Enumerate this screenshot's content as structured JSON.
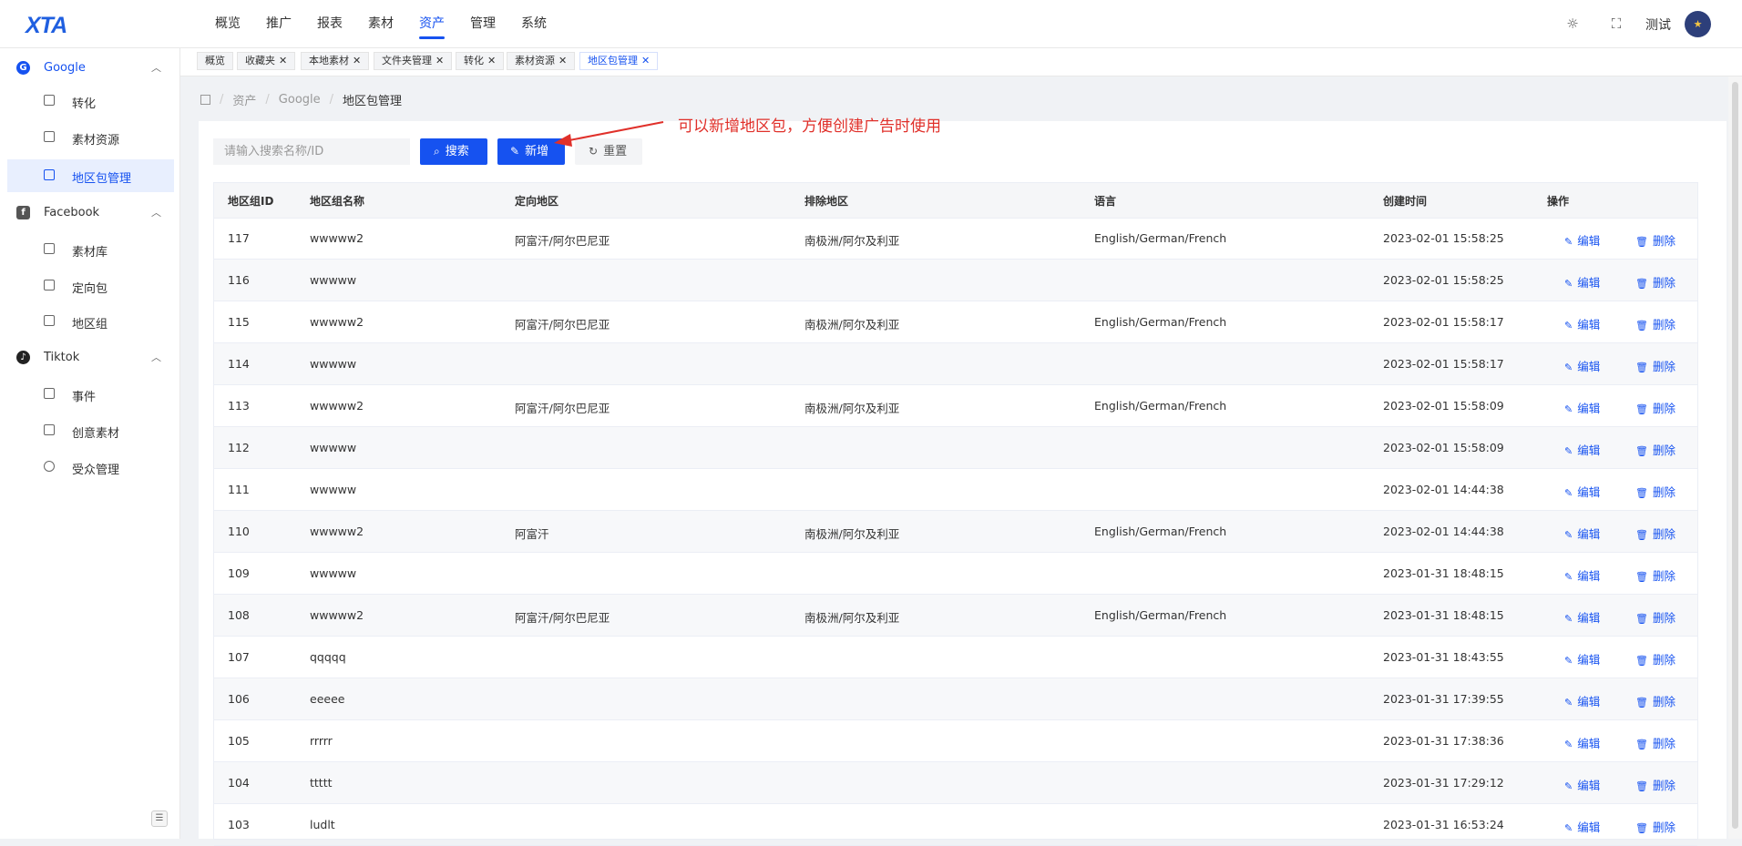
{
  "header": {
    "logo": "XTA",
    "nav": [
      "概览",
      "推广",
      "报表",
      "素材",
      "资产",
      "管理",
      "系统"
    ],
    "active_nav": "资产",
    "username": "测试"
  },
  "sidebar": {
    "groups": [
      {
        "label": "Google",
        "icon": "google-icon",
        "expanded": true,
        "items": [
          {
            "label": "转化",
            "icon": "paint-roller-icon"
          },
          {
            "label": "素材资源",
            "icon": "tv-icon"
          },
          {
            "label": "地区包管理",
            "icon": "list-icon",
            "active": true
          }
        ]
      },
      {
        "label": "Facebook",
        "icon": "facebook-icon",
        "expanded": true,
        "items": [
          {
            "label": "素材库",
            "icon": "tv-icon"
          },
          {
            "label": "定向包",
            "icon": "list-icon"
          },
          {
            "label": "地区组",
            "icon": "list-icon"
          }
        ]
      },
      {
        "label": "Tiktok",
        "icon": "tiktok-icon",
        "expanded": true,
        "items": [
          {
            "label": "事件",
            "icon": "paint-roller-icon"
          },
          {
            "label": "创意素材",
            "icon": "tv-icon"
          },
          {
            "label": "受众管理",
            "icon": "users-icon"
          }
        ]
      }
    ]
  },
  "tags": [
    {
      "label": "概览",
      "closable": false
    },
    {
      "label": "收藏夹",
      "closable": true
    },
    {
      "label": "本地素材",
      "closable": true
    },
    {
      "label": "文件夹管理",
      "closable": true
    },
    {
      "label": "转化",
      "closable": true
    },
    {
      "label": "素材资源",
      "closable": true
    },
    {
      "label": "地区包管理",
      "closable": true,
      "active": true
    }
  ],
  "breadcrumb": [
    "资产",
    "Google",
    "地区包管理"
  ],
  "toolbar": {
    "search_placeholder": "请输入搜索名称/ID",
    "search_label": "搜索",
    "add_label": "新增",
    "reset_label": "重置"
  },
  "annotation": "可以新增地区包，方便创建广告时使用",
  "table": {
    "columns": [
      "地区组ID",
      "地区组名称",
      "定向地区",
      "排除地区",
      "语言",
      "创建时间",
      "操作"
    ],
    "edit_label": "编辑",
    "delete_label": "删除",
    "rows": [
      {
        "id": "117",
        "name": "wwwww2",
        "target": "阿富汗/阿尔巴尼亚",
        "exclude": "南极洲/阿尔及利亚",
        "lang": "English/German/French",
        "created": "2023-02-01 15:58:25"
      },
      {
        "id": "116",
        "name": "wwwww",
        "target": "",
        "exclude": "",
        "lang": "",
        "created": "2023-02-01 15:58:25"
      },
      {
        "id": "115",
        "name": "wwwww2",
        "target": "阿富汗/阿尔巴尼亚",
        "exclude": "南极洲/阿尔及利亚",
        "lang": "English/German/French",
        "created": "2023-02-01 15:58:17"
      },
      {
        "id": "114",
        "name": "wwwww",
        "target": "",
        "exclude": "",
        "lang": "",
        "created": "2023-02-01 15:58:17"
      },
      {
        "id": "113",
        "name": "wwwww2",
        "target": "阿富汗/阿尔巴尼亚",
        "exclude": "南极洲/阿尔及利亚",
        "lang": "English/German/French",
        "created": "2023-02-01 15:58:09"
      },
      {
        "id": "112",
        "name": "wwwww",
        "target": "",
        "exclude": "",
        "lang": "",
        "created": "2023-02-01 15:58:09"
      },
      {
        "id": "111",
        "name": "wwwww",
        "target": "",
        "exclude": "",
        "lang": "",
        "created": "2023-02-01 14:44:38"
      },
      {
        "id": "110",
        "name": "wwwww2",
        "target": "阿富汗",
        "exclude": "南极洲/阿尔及利亚",
        "lang": "English/German/French",
        "created": "2023-02-01 14:44:38"
      },
      {
        "id": "109",
        "name": "wwwww",
        "target": "",
        "exclude": "",
        "lang": "",
        "created": "2023-01-31 18:48:15"
      },
      {
        "id": "108",
        "name": "wwwww2",
        "target": "阿富汗/阿尔巴尼亚",
        "exclude": "南极洲/阿尔及利亚",
        "lang": "English/German/French",
        "created": "2023-01-31 18:48:15"
      },
      {
        "id": "107",
        "name": "qqqqq",
        "target": "",
        "exclude": "",
        "lang": "",
        "created": "2023-01-31 18:43:55"
      },
      {
        "id": "106",
        "name": "eeeee",
        "target": "",
        "exclude": "",
        "lang": "",
        "created": "2023-01-31 17:39:55"
      },
      {
        "id": "105",
        "name": "rrrrr",
        "target": "",
        "exclude": "",
        "lang": "",
        "created": "2023-01-31 17:38:36"
      },
      {
        "id": "104",
        "name": "ttttt",
        "target": "",
        "exclude": "",
        "lang": "",
        "created": "2023-01-31 17:29:12"
      },
      {
        "id": "103",
        "name": "ludlt",
        "target": "",
        "exclude": "",
        "lang": "",
        "created": "2023-01-31 16:53:24"
      }
    ]
  },
  "colors": {
    "primary": "#1652f0",
    "annotation": "#e0302a"
  }
}
